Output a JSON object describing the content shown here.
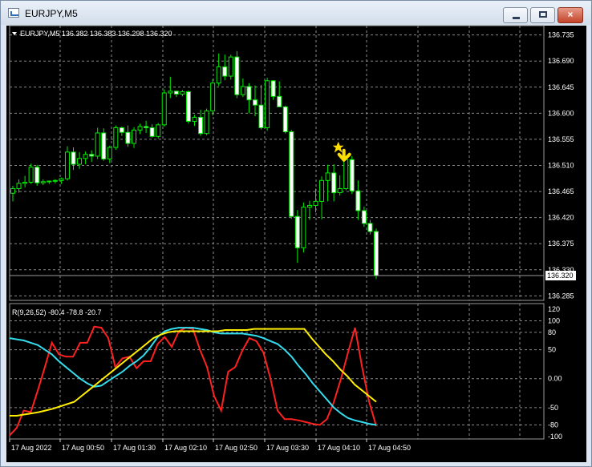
{
  "window": {
    "title": "EURJPY,M5",
    "close_glyph": "×",
    "icons": [
      "chart-window-icon",
      "minimize-icon",
      "maximize-icon",
      "close-icon"
    ]
  },
  "chart_data": {
    "type": "candlestick",
    "symbol_label": "EURJPY,M5",
    "ohlc_label": "136.382 136.383 136.298 136.320",
    "price_axis_ticks": [
      "136.735",
      "136.690",
      "136.645",
      "136.600",
      "136.555",
      "136.510",
      "136.465",
      "136.420",
      "136.375",
      "136.330",
      "136.285"
    ],
    "current_price_label": "136.320",
    "ylim": [
      136.28,
      136.74
    ],
    "indicator_label": "R(9,26,52) -80.4 -78.8 -20.7",
    "indicator_ticks": [
      "120",
      "100",
      "80",
      "50",
      "0.00",
      "-50",
      "-80",
      "-100"
    ],
    "indicator_ylim": [
      -100,
      120
    ],
    "time_ticks": [
      "17 Aug 2022",
      "17 Aug 00:50",
      "17 Aug 01:30",
      "17 Aug 02:10",
      "17 Aug 02:50",
      "17 Aug 03:30",
      "17 Aug 04:10",
      "17 Aug 04:50"
    ],
    "candles": [
      [
        136.462,
        136.475,
        136.448,
        136.47
      ],
      [
        136.47,
        136.486,
        136.463,
        136.479
      ],
      [
        136.479,
        136.492,
        136.472,
        136.481
      ],
      [
        136.481,
        136.513,
        136.478,
        136.507
      ],
      [
        136.507,
        136.511,
        136.475,
        136.48
      ],
      [
        136.48,
        136.486,
        136.476,
        136.482
      ],
      [
        136.482,
        136.484,
        136.478,
        136.483
      ],
      [
        136.483,
        136.486,
        136.479,
        136.484
      ],
      [
        136.484,
        136.489,
        136.478,
        136.487
      ],
      [
        136.487,
        136.543,
        136.484,
        136.533
      ],
      [
        136.533,
        136.541,
        136.502,
        136.512
      ],
      [
        136.512,
        136.533,
        136.504,
        136.522
      ],
      [
        136.522,
        136.534,
        136.512,
        136.529
      ],
      [
        136.529,
        136.536,
        136.516,
        136.526
      ],
      [
        136.526,
        136.575,
        136.521,
        136.566
      ],
      [
        136.566,
        136.574,
        136.518,
        136.521
      ],
      [
        136.521,
        136.544,
        136.514,
        136.541
      ],
      [
        136.541,
        136.579,
        136.537,
        136.575
      ],
      [
        136.575,
        136.577,
        136.561,
        136.567
      ],
      [
        136.567,
        136.579,
        136.542,
        136.548
      ],
      [
        136.548,
        136.576,
        136.54,
        136.571
      ],
      [
        136.571,
        136.582,
        136.564,
        136.577
      ],
      [
        136.577,
        136.587,
        136.566,
        136.575
      ],
      [
        136.575,
        136.581,
        136.558,
        136.56
      ],
      [
        136.56,
        136.583,
        136.556,
        136.58
      ],
      [
        136.58,
        136.641,
        136.577,
        136.635
      ],
      [
        136.635,
        136.663,
        136.626,
        136.638
      ],
      [
        136.638,
        136.639,
        136.628,
        136.633
      ],
      [
        136.633,
        136.64,
        136.629,
        136.637
      ],
      [
        136.637,
        136.639,
        136.582,
        136.586
      ],
      [
        136.586,
        136.597,
        136.578,
        136.593
      ],
      [
        136.593,
        136.606,
        136.561,
        136.565
      ],
      [
        136.565,
        136.608,
        136.562,
        136.604
      ],
      [
        136.604,
        136.659,
        136.596,
        136.652
      ],
      [
        136.652,
        136.703,
        136.647,
        136.68
      ],
      [
        136.68,
        136.701,
        136.657,
        136.664
      ],
      [
        136.664,
        136.701,
        136.658,
        136.697
      ],
      [
        136.697,
        136.707,
        136.626,
        136.632
      ],
      [
        136.632,
        136.66,
        136.628,
        136.646
      ],
      [
        136.646,
        136.652,
        136.6,
        136.623
      ],
      [
        136.623,
        136.648,
        136.595,
        136.614
      ],
      [
        136.614,
        136.649,
        136.572,
        136.575
      ],
      [
        136.575,
        136.661,
        136.57,
        136.656
      ],
      [
        136.656,
        136.657,
        136.623,
        136.629
      ],
      [
        136.629,
        136.655,
        136.611,
        136.611
      ],
      [
        136.611,
        136.613,
        136.565,
        136.568
      ],
      [
        136.568,
        136.571,
        136.418,
        136.422
      ],
      [
        136.422,
        136.433,
        136.342,
        136.368
      ],
      [
        136.368,
        136.446,
        136.36,
        136.438
      ],
      [
        136.438,
        136.449,
        136.416,
        136.441
      ],
      [
        136.441,
        136.47,
        136.429,
        136.448
      ],
      [
        136.448,
        136.491,
        136.417,
        136.484
      ],
      [
        136.484,
        136.511,
        136.448,
        136.497
      ],
      [
        136.497,
        136.512,
        136.448,
        136.463
      ],
      [
        136.463,
        136.493,
        136.458,
        136.47
      ],
      [
        136.47,
        136.525,
        136.467,
        136.52
      ],
      [
        136.52,
        136.526,
        136.461,
        136.466
      ],
      [
        136.466,
        136.484,
        136.416,
        136.432
      ],
      [
        136.432,
        136.439,
        136.404,
        136.41
      ],
      [
        136.41,
        136.416,
        136.391,
        136.396
      ],
      [
        136.396,
        136.401,
        136.314,
        136.32
      ]
    ],
    "signal_marker_index": 54,
    "series": [
      {
        "color": "#ff2020",
        "values": [
          -98,
          -85,
          -55,
          -58,
          -20,
          20,
          62,
          42,
          38,
          38,
          62,
          62,
          90,
          88,
          70,
          20,
          35,
          38,
          18,
          30,
          30,
          60,
          72,
          55,
          82,
          88,
          86,
          50,
          20,
          -30,
          -55,
          12,
          20,
          48,
          70,
          65,
          45,
          0,
          -55,
          -70,
          -70,
          -72,
          -75,
          -78,
          -80,
          -70,
          -40,
          0,
          45,
          88,
          20,
          -40,
          -82
        ]
      },
      {
        "color": "#33ddee",
        "values": [
          70,
          68,
          66,
          62,
          58,
          50,
          42,
          30,
          20,
          10,
          0,
          -8,
          -14,
          -12,
          -4,
          4,
          12,
          22,
          30,
          40,
          55,
          72,
          82,
          86,
          88,
          88,
          88,
          86,
          84,
          80,
          78,
          78,
          78,
          78,
          76,
          74,
          70,
          65,
          60,
          50,
          38,
          22,
          8,
          -8,
          -22,
          -36,
          -50,
          -60,
          -68,
          -72,
          -75,
          -78,
          -80
        ]
      },
      {
        "color": "#ffee00",
        "values": [
          -64,
          -64,
          -62,
          -60,
          -58,
          -55,
          -52,
          -48,
          -44,
          -40,
          -30,
          -20,
          -10,
          0,
          10,
          20,
          30,
          40,
          50,
          60,
          70,
          76,
          80,
          82,
          82,
          82,
          82,
          82,
          82,
          82,
          84,
          84,
          84,
          84,
          86,
          86,
          86,
          86,
          86,
          86,
          86,
          86,
          70,
          56,
          42,
          30,
          16,
          4,
          -10,
          -20,
          -30,
          -40
        ]
      }
    ]
  }
}
